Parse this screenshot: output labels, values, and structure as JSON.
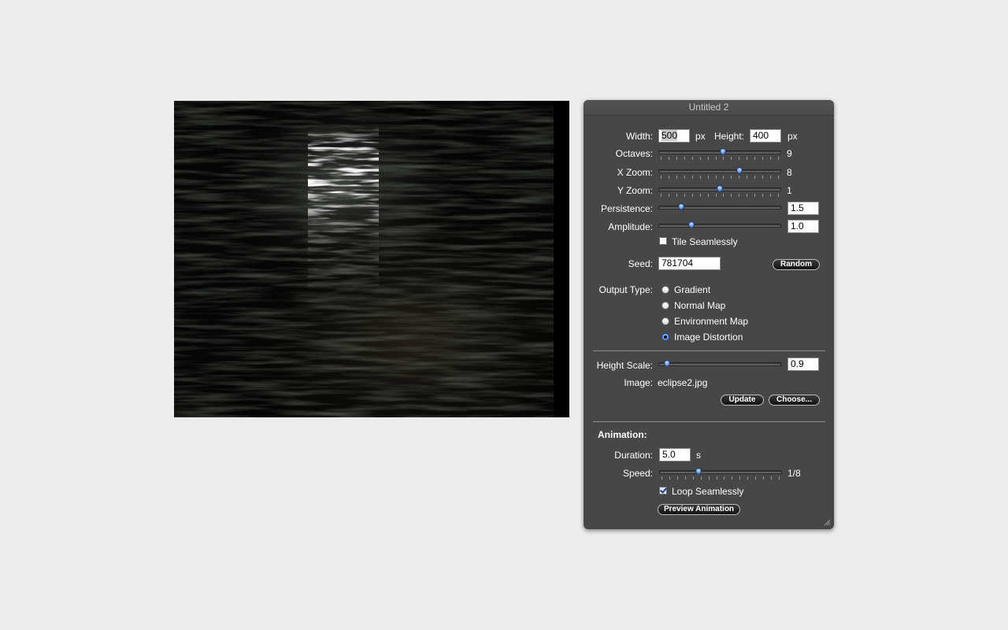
{
  "window": {
    "title": "Untitled 2"
  },
  "size": {
    "width_label": "Width:",
    "width_value": "500",
    "width_unit": "px",
    "height_label": "Height:",
    "height_value": "400",
    "height_unit": "px"
  },
  "octaves": {
    "label": "Octaves:",
    "value": "9",
    "level": 0.53
  },
  "x_zoom": {
    "label": "X Zoom:",
    "value": "8",
    "level": 0.67
  },
  "y_zoom": {
    "label": "Y Zoom:",
    "value": "1",
    "level": 0.5
  },
  "persistence": {
    "label": "Persistence:",
    "value": "1.5",
    "level": 0.17
  },
  "amplitude": {
    "label": "Amplitude:",
    "value": "1.0",
    "level": 0.26
  },
  "tile": {
    "label": "Tile Seamlessly",
    "checked": false
  },
  "seed": {
    "label": "Seed:",
    "value": "781704",
    "random_label": "Random"
  },
  "output_type": {
    "label": "Output Type:",
    "options": [
      "Gradient",
      "Normal Map",
      "Environment Map",
      "Image Distortion"
    ],
    "selected": "Image Distortion"
  },
  "height_scale": {
    "label": "Height Scale:",
    "value": "0.9",
    "level": 0.05
  },
  "image": {
    "label": "Image:",
    "value": "eclipse2.jpg",
    "update_label": "Update",
    "choose_label": "Choose..."
  },
  "animation": {
    "heading": "Animation:",
    "duration_label": "Duration:",
    "duration_value": "5.0",
    "duration_unit": "s",
    "speed_label": "Speed:",
    "speed_value": "1/8",
    "speed_level": 0.31,
    "loop_label": "Loop Seamlessly",
    "loop_checked": true,
    "preview_label": "Preview Animation"
  }
}
